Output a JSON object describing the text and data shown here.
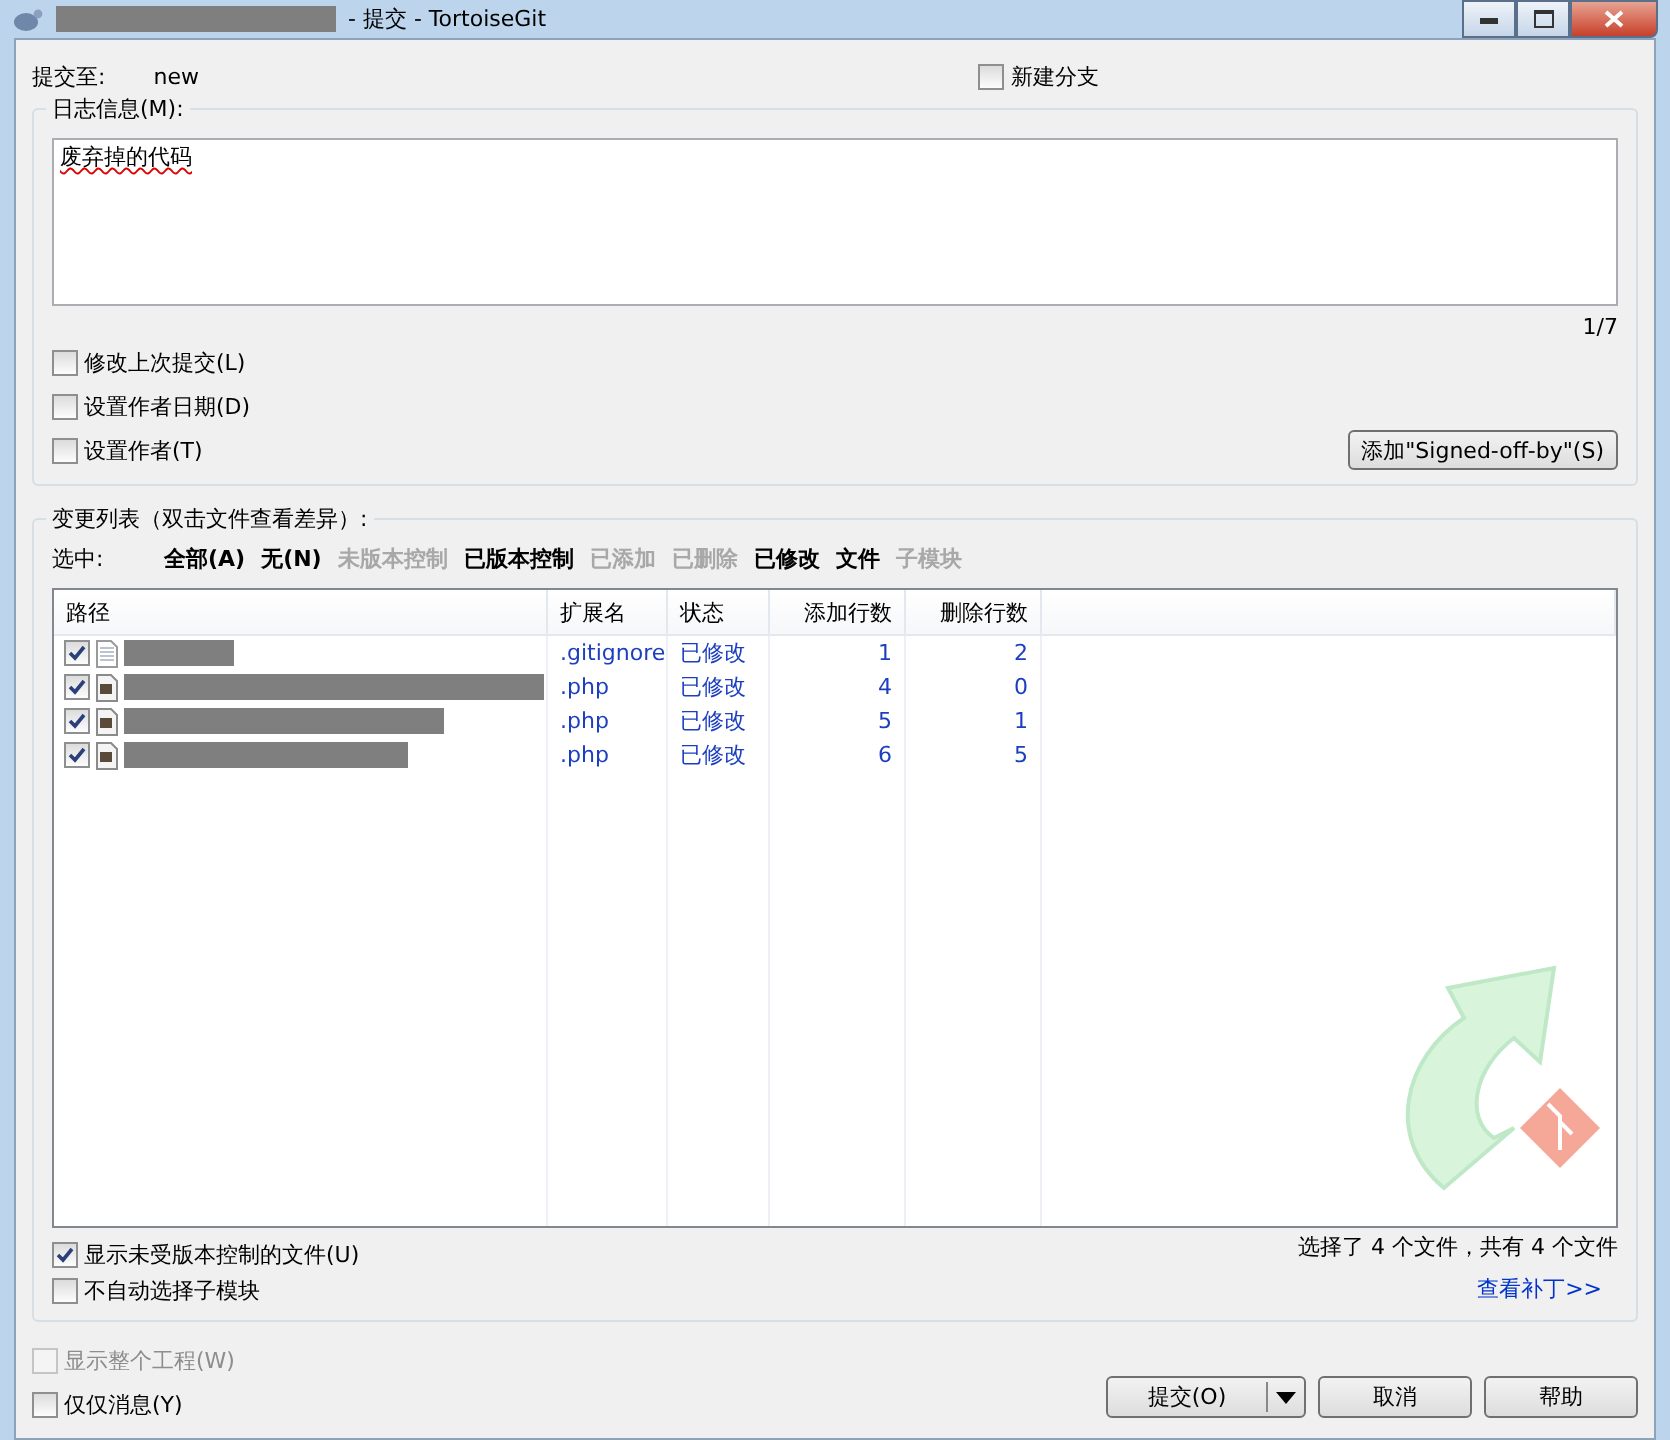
{
  "window": {
    "title": "- 提交 - TortoiseGit"
  },
  "commit_to": {
    "label": "提交至:",
    "value": "new"
  },
  "new_branch": {
    "label": "新建分支",
    "checked": false
  },
  "message_group": {
    "title": "日志信息(M):",
    "message": "废弃掉的代码",
    "counter": "1/7",
    "options": [
      {
        "label": "修改上次提交(L)",
        "checked": false
      },
      {
        "label": "设置作者日期(D)",
        "checked": false
      },
      {
        "label": "设置作者(T)",
        "checked": false
      }
    ],
    "signoff_button": "添加\"Signed-off-by\"(S)"
  },
  "changes_group": {
    "title": "变更列表（双击文件查看差异）:",
    "filter_label": "选中:",
    "filters": [
      {
        "label": "全部(A)",
        "disabled": false
      },
      {
        "label": "无(N)",
        "disabled": false
      },
      {
        "label": "未版本控制",
        "disabled": true
      },
      {
        "label": "已版本控制",
        "disabled": false
      },
      {
        "label": "已添加",
        "disabled": true
      },
      {
        "label": "已删除",
        "disabled": true
      },
      {
        "label": "已修改",
        "disabled": false
      },
      {
        "label": "文件",
        "disabled": false
      },
      {
        "label": "子模块",
        "disabled": true
      }
    ],
    "columns": [
      "路径",
      "扩展名",
      "状态",
      "添加行数",
      "删除行数"
    ],
    "rows": [
      {
        "checked": true,
        "kind": "text",
        "extension": ".gitignore",
        "status": "已修改",
        "added": "1",
        "deleted": "2"
      },
      {
        "checked": true,
        "kind": "php",
        "extension": ".php",
        "status": "已修改",
        "added": "4",
        "deleted": "0"
      },
      {
        "checked": true,
        "kind": "php",
        "extension": ".php",
        "status": "已修改",
        "added": "5",
        "deleted": "1"
      },
      {
        "checked": true,
        "kind": "php",
        "extension": ".php",
        "status": "已修改",
        "added": "6",
        "deleted": "5"
      }
    ],
    "options": [
      {
        "label": "显示未受版本控制的文件(U)",
        "checked": true
      },
      {
        "label": "不自动选择子模块",
        "checked": false
      }
    ],
    "selection_summary": "选择了 4 个文件，共有 4 个文件",
    "view_patch_link": "查看补丁>>"
  },
  "bottom_options": [
    {
      "label": "显示整个工程(W)",
      "checked": false,
      "disabled": true
    },
    {
      "label": "仅仅消息(Y)",
      "checked": false,
      "disabled": false
    }
  ],
  "buttons": {
    "commit": "提交(O)",
    "cancel": "取消",
    "help": "帮助"
  }
}
